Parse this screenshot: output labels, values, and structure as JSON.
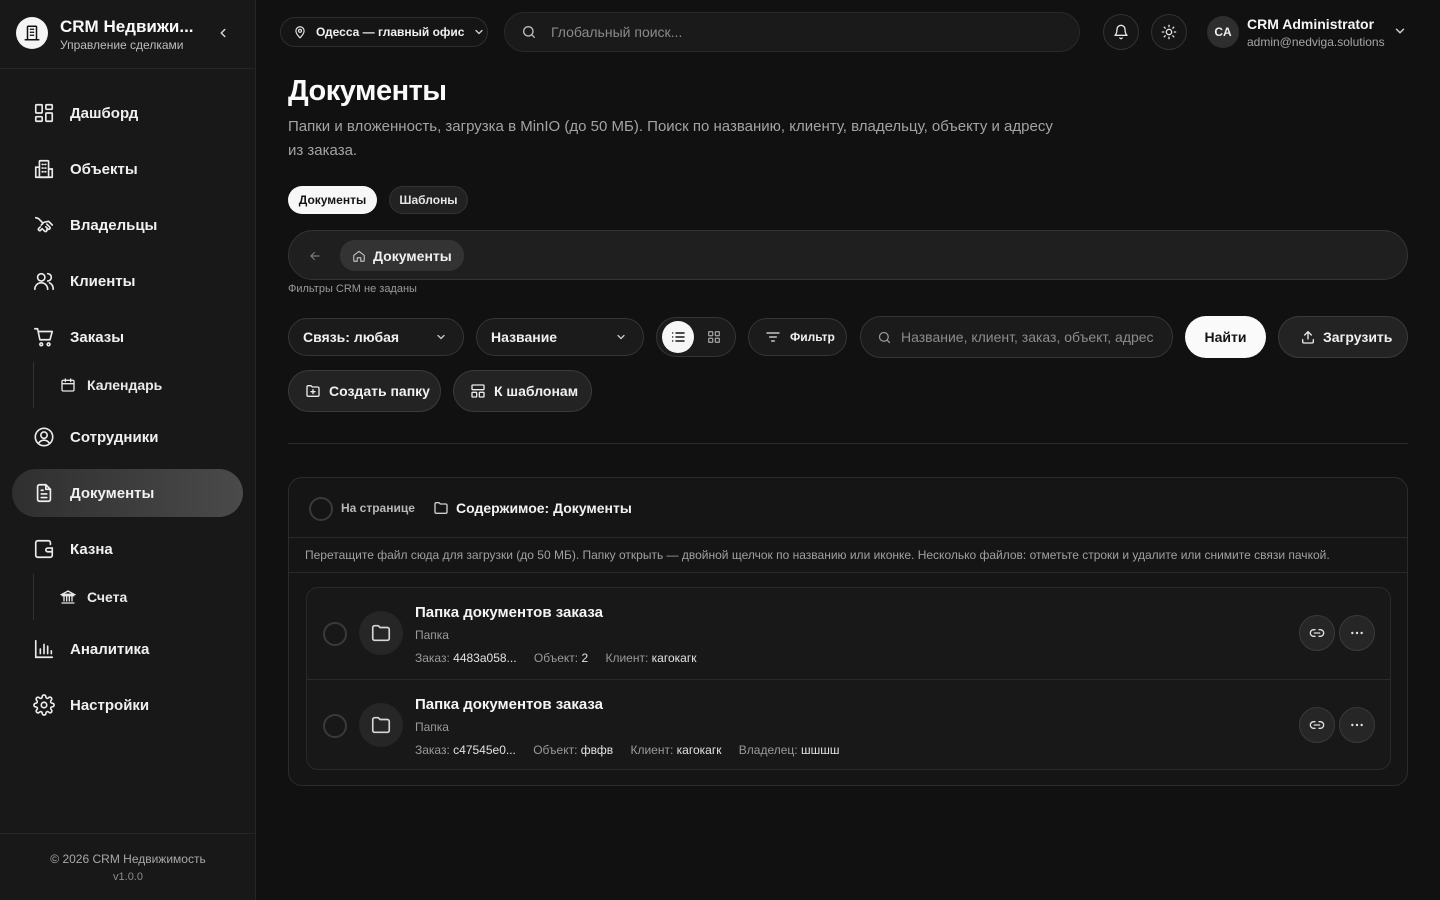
{
  "brand": {
    "title": "CRM Недвижи...",
    "subtitle": "Управление сделками"
  },
  "sidebar": {
    "items": [
      {
        "label": "Дашборд",
        "icon": "dashboard-icon"
      },
      {
        "label": "Объекты",
        "icon": "building-icon"
      },
      {
        "label": "Владельцы",
        "icon": "handshake-icon"
      },
      {
        "label": "Клиенты",
        "icon": "users-icon"
      },
      {
        "label": "Заказы",
        "icon": "cart-icon"
      },
      {
        "label": "Календарь",
        "icon": "calendar-icon",
        "sub": true
      },
      {
        "label": "Сотрудники",
        "icon": "user-circle-icon"
      },
      {
        "label": "Документы",
        "icon": "document-icon",
        "active": true
      },
      {
        "label": "Казна",
        "icon": "wallet-icon"
      },
      {
        "label": "Счета",
        "icon": "bank-icon",
        "sub": true
      },
      {
        "label": "Аналитика",
        "icon": "chart-icon"
      },
      {
        "label": "Настройки",
        "icon": "gear-icon"
      }
    ],
    "footer": {
      "copyright": "© 2026 CRM Недвижимость",
      "version": "v1.0.0"
    }
  },
  "header": {
    "office": "Одесса — главный офис",
    "search_placeholder": "Глобальный поиск...",
    "user": {
      "initials": "CA",
      "name": "CRM Administrator",
      "email": "admin@nedviga.solutions"
    }
  },
  "page": {
    "title": "Документы",
    "description": "Папки и вложенность, загрузка в MinIO (до 50 МБ). Поиск по названию, клиенту, владельцу, объекту и адресу из заказа.",
    "tabs": [
      {
        "label": "Документы",
        "active": true
      },
      {
        "label": "Шаблоны",
        "active": false
      }
    ],
    "breadcrumb": "Документы",
    "crm_filters_note": "Фильтры CRM не заданы"
  },
  "toolbar": {
    "link_select": "Связь: любая",
    "sort_select": "Название",
    "filter_label": "Фильтр",
    "search_placeholder": "Название, клиент, заказ, объект, адрес",
    "find_label": "Найти",
    "upload_label": "Загрузить",
    "create_folder_label": "Создать папку",
    "to_templates_label": "К шаблонам"
  },
  "panel": {
    "page_select_label": "На странице",
    "title": "Содержимое: Документы",
    "hint": "Перетащите файл сюда для загрузки (до 50 МБ). Папку открыть — двойной щелчок по названию или иконке. Несколько файлов: отметьте строки и удалите или снимите связи пачкой."
  },
  "rows": [
    {
      "name": "Папка документов заказа",
      "type": "Папка",
      "meta": [
        {
          "k": "Заказ:",
          "v": "4483a058..."
        },
        {
          "k": "Объект:",
          "v": "2"
        },
        {
          "k": "Клиент:",
          "v": "кагокагк"
        }
      ]
    },
    {
      "name": "Папка документов заказа",
      "type": "Папка",
      "meta": [
        {
          "k": "Заказ:",
          "v": "c47545e0..."
        },
        {
          "k": "Объект:",
          "v": "фвфв"
        },
        {
          "k": "Клиент:",
          "v": "кагокагк"
        },
        {
          "k": "Владелец:",
          "v": "шшшш"
        }
      ]
    }
  ]
}
